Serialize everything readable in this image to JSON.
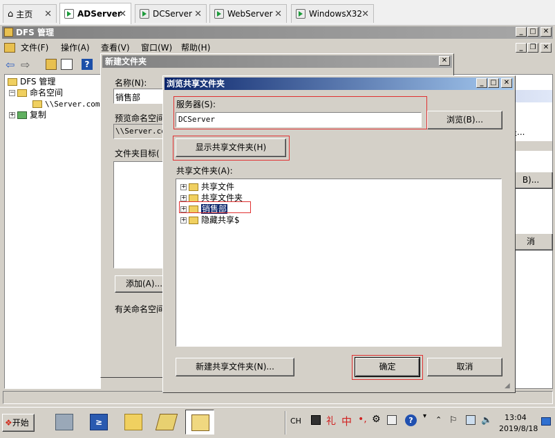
{
  "tabs": [
    {
      "label": "主页",
      "active": false
    },
    {
      "label": "ADServer",
      "active": true
    },
    {
      "label": "DCServer",
      "active": false
    },
    {
      "label": "WebServer",
      "active": false
    },
    {
      "label": "WindowsX32",
      "active": false
    }
  ],
  "mmc": {
    "title": "DFS 管理",
    "menu": [
      "文件(F)",
      "操作(A)",
      "查看(V)",
      "窗口(W)",
      "帮助(H)"
    ],
    "tree": {
      "root": "DFS 管理",
      "namespaces": "命名空间",
      "namespace_item": "\\\\Server.com\\",
      "replication": "复制"
    },
    "right_btn_b": "B)...",
    "right_btn_cancel": "消",
    "right_text": "是..."
  },
  "new_folder": {
    "title": "新建文件夹",
    "name_label": "名称(N):",
    "name_value": "销售部",
    "preview_label": "预览命名空间",
    "preview_value": "\\\\Server.com",
    "targets_label": "文件夹目标(",
    "add_button": "添加(A)...",
    "note": "有关命名空间"
  },
  "browse": {
    "title": "浏览共享文件夹",
    "server_label": "服务器(S):",
    "server_value": "DCServer",
    "browse_button": "浏览(B)...",
    "show_button": "显示共享文件夹(H)",
    "shared_label": "共享文件夹(A):",
    "folders": [
      "共享文件",
      "共享文件夹",
      "销售部",
      "隐藏共享$"
    ],
    "selected_index": 2,
    "new_button": "新建共享文件夹(N)...",
    "ok_button": "确定",
    "cancel_button": "取消"
  },
  "taskbar": {
    "start": "开始",
    "lang": "CH",
    "ime": "中",
    "time": "13:04",
    "date": "2019/8/18"
  }
}
